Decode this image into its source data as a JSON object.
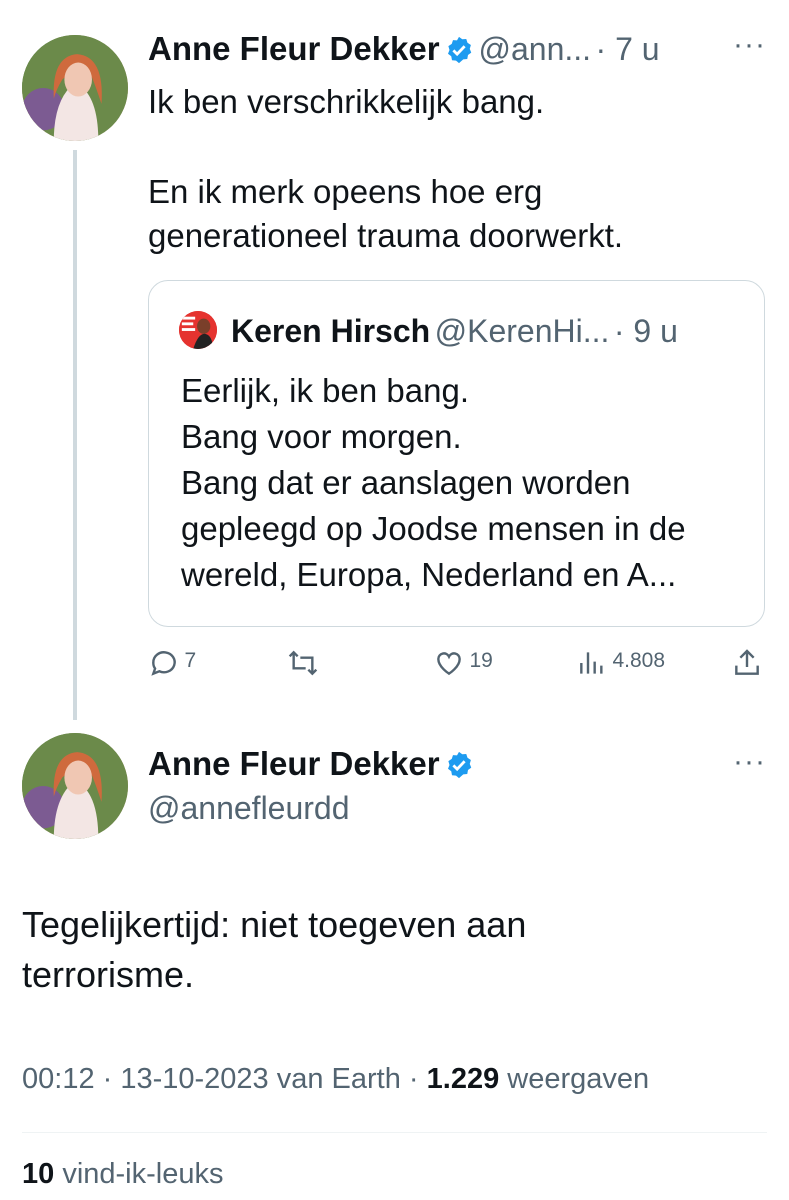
{
  "tweet1": {
    "name": "Anne Fleur Dekker",
    "handle": "@ann...",
    "time": "· 7 u",
    "text_line1": "Ik ben verschrikkelijk bang.",
    "text_line2": "En ik merk opeens hoe erg",
    "text_line3": "generationeel trauma doorwerkt.",
    "more": "···",
    "quote": {
      "name": "Keren Hirsch",
      "handle": "@KerenHi...",
      "time": "· 9 u",
      "lines": [
        "Eerlijk, ik ben bang.",
        "Bang voor morgen.",
        "Bang dat er aanslagen worden",
        "gepleegd op Joodse mensen in de",
        "wereld, Europa, Nederland en A..."
      ]
    },
    "actions": {
      "replies": "7",
      "likes": "19",
      "views": "4.808"
    }
  },
  "tweet2": {
    "name": "Anne Fleur Dekker",
    "handle": "@annefleurdd",
    "more": "···",
    "text_line1": "Tegelijkertijd: niet toegeven aan",
    "text_line2": "terrorisme.",
    "meta_time": "00:12 · 13-10-2023 van Earth ·",
    "meta_views": "1.229",
    "meta_views_label": "weergaven",
    "likes_count": "10",
    "likes_label": "vind-ik-leuks"
  },
  "colors": {
    "verified": "#1d9bf0",
    "muted": "#536471",
    "border": "#cfd9de"
  }
}
